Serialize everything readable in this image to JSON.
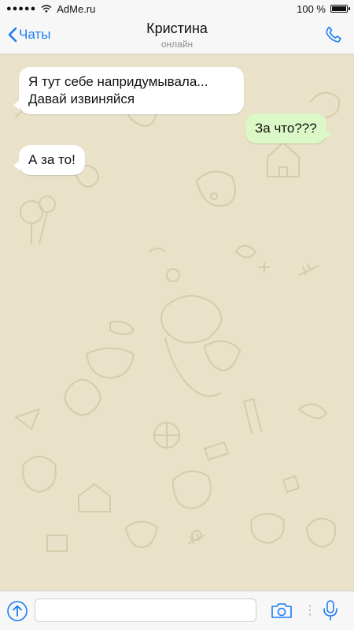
{
  "status_bar": {
    "carrier": "AdMe.ru",
    "battery": "100 %",
    "signal_dots": "●●●●●"
  },
  "header": {
    "back_label": "Чаты",
    "contact_name": "Кристина",
    "contact_status": "онлайн"
  },
  "messages": [
    {
      "direction": "incoming",
      "text": "Я тут себе напридумывала... Давай извиняйся"
    },
    {
      "direction": "outgoing",
      "text": "За что???"
    },
    {
      "direction": "incoming",
      "text": "А за то!"
    }
  ],
  "input": {
    "placeholder": ""
  },
  "colors": {
    "accent": "#1a7cf4",
    "chat_background": "#e9e2c8",
    "incoming_bubble": "#ffffff",
    "outgoing_bubble": "#dcf8c6"
  },
  "icons": {
    "back": "chevron-left-icon",
    "call": "phone-icon",
    "attach": "upload-icon",
    "camera": "camera-icon",
    "mic": "microphone-icon"
  }
}
